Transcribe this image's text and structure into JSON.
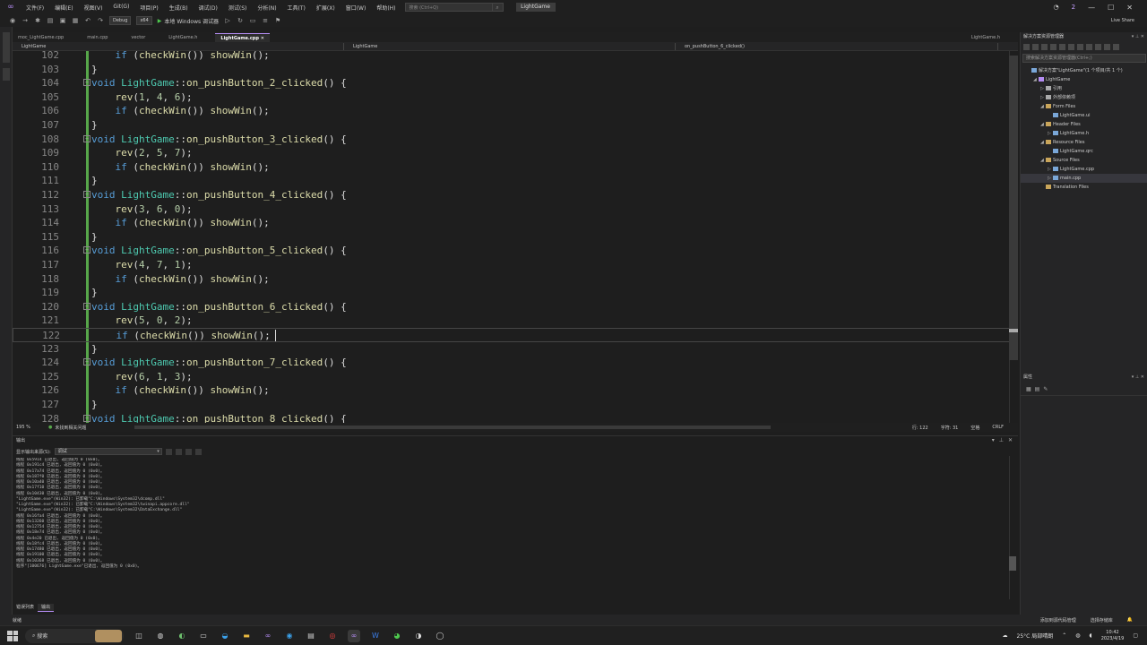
{
  "menu": {
    "items": [
      "文件(F)",
      "编辑(E)",
      "视图(V)",
      "Git(G)",
      "项目(P)",
      "生成(B)",
      "调试(D)",
      "测试(S)",
      "分析(N)",
      "工具(T)",
      "扩展(X)",
      "窗口(W)",
      "帮助(H)"
    ],
    "search_placeholder": "搜索 (Ctrl+Q)",
    "app_title": "LightGame",
    "notif_count": "2"
  },
  "toolbar": {
    "config": "Debug",
    "platform": "x64",
    "run_label": "本地 Windows 调试器",
    "live_share": "Live Share"
  },
  "tabs": [
    "moc_LightGame.cpp",
    "main.cpp",
    "vector",
    "LightGame.h",
    "LightGame.cpp",
    "LightGame.h"
  ],
  "navbar": {
    "project": "LightGame",
    "scope": "LightGame",
    "member": "on_pushButton_6_clicked()"
  },
  "code_lines": [
    {
      "n": "102",
      "t": "    if (checkWin()) showWin();"
    },
    {
      "n": "103",
      "t": "}"
    },
    {
      "n": "104",
      "t": "void LightGame::on_pushButton_2_clicked() {"
    },
    {
      "n": "105",
      "t": "    rev(1, 4, 6);"
    },
    {
      "n": "106",
      "t": "    if (checkWin()) showWin();"
    },
    {
      "n": "107",
      "t": "}"
    },
    {
      "n": "108",
      "t": "void LightGame::on_pushButton_3_clicked() {"
    },
    {
      "n": "109",
      "t": "    rev(2, 5, 7);"
    },
    {
      "n": "110",
      "t": "    if (checkWin()) showWin();"
    },
    {
      "n": "111",
      "t": "}"
    },
    {
      "n": "112",
      "t": "void LightGame::on_pushButton_4_clicked() {"
    },
    {
      "n": "113",
      "t": "    rev(3, 6, 0);"
    },
    {
      "n": "114",
      "t": "    if (checkWin()) showWin();"
    },
    {
      "n": "115",
      "t": "}"
    },
    {
      "n": "116",
      "t": "void LightGame::on_pushButton_5_clicked() {"
    },
    {
      "n": "117",
      "t": "    rev(4, 7, 1);"
    },
    {
      "n": "118",
      "t": "    if (checkWin()) showWin();"
    },
    {
      "n": "119",
      "t": "}"
    },
    {
      "n": "120",
      "t": "void LightGame::on_pushButton_6_clicked() {"
    },
    {
      "n": "121",
      "t": "    rev(5, 0, 2);"
    },
    {
      "n": "122",
      "t": "    if (checkWin()) showWin();"
    },
    {
      "n": "123",
      "t": "}"
    },
    {
      "n": "124",
      "t": "void LightGame::on_pushButton_7_clicked() {"
    },
    {
      "n": "125",
      "t": "    rev(6, 1, 3);"
    },
    {
      "n": "126",
      "t": "    if (checkWin()) showWin();"
    },
    {
      "n": "127",
      "t": "}"
    },
    {
      "n": "128",
      "t": "void LightGame::on_pushButton_8_clicked() {"
    }
  ],
  "current_line": "122",
  "editor_status": {
    "zoom": "195 %",
    "issues": "未找到相关问题",
    "line": "行: 122",
    "col": "字符: 31",
    "mode": "空格",
    "eol": "CRLF"
  },
  "output": {
    "title": "输出",
    "source_label": "显示输出来源(S):",
    "source_value": "调试",
    "lines": [
      "线程 0x5914 已退出, 返回值为 0 (0x0)。",
      "线程 0x191c4 已退出, 返回值为 0 (0x0)。",
      "线程 0x17a74 已退出, 返回值为 0 (0x0)。",
      "线程 0x187f0 已退出, 返回值为 0 (0x0)。",
      "线程 0x10a40 已退出, 返回值为 0 (0x0)。",
      "线程 0x17f10 已退出, 返回值为 0 (0x0)。",
      "线程 0x10430 已退出, 返回值为 0 (0x0)。",
      "\"LightGame.exe\"(Win32): 已卸载\"C:\\Windows\\System32\\dcomp.dll\"",
      "\"LightGame.exe\"(Win32): 已卸载\"C:\\Windows\\System32\\twinapi.appcore.dll\"",
      "\"LightGame.exe\"(Win32): 已卸载\"C:\\Windows\\System32\\DataExchange.dll\"",
      "线程 0x16fa4 已退出, 返回值为 0 (0x0)。",
      "线程 0x13260 已退出, 返回值为 0 (0x0)。",
      "线程 0x12754 已退出, 返回值为 0 (0x0)。",
      "线程 0x18e74 已退出, 返回值为 0 (0x0)。",
      "线程 0x4e20 已退出, 返回值为 0 (0x0)。",
      "线程 0x18fc4 已退出, 返回值为 0 (0x0)。",
      "线程 0x17480 已退出, 返回值为 0 (0x0)。",
      "线程 0x19100 已退出, 返回值为 0 (0x0)。",
      "线程 0x10368 已退出, 返回值为 0 (0x0)。",
      "程序\"[100676] LightGame.exe\"已退出, 返回值为 0 (0x0)。"
    ]
  },
  "bottom_tabs": [
    "错误列表",
    "输出"
  ],
  "solution": {
    "title": "解决方案资源管理器",
    "search_placeholder": "搜索解决方案资源管理器(Ctrl+;)",
    "items": [
      {
        "label": "解决方案\"LightGame\"(1 个项目/共 1 个)",
        "indent": 0,
        "arrow": ""
      },
      {
        "label": "LightGame",
        "indent": 1,
        "arrow": "◢"
      },
      {
        "label": "引用",
        "indent": 2,
        "arrow": "▷"
      },
      {
        "label": "外部依赖项",
        "indent": 2,
        "arrow": "▷"
      },
      {
        "label": "Form Files",
        "indent": 2,
        "arrow": "◢"
      },
      {
        "label": "LightGame.ui",
        "indent": 3,
        "arrow": ""
      },
      {
        "label": "Header Files",
        "indent": 2,
        "arrow": "◢"
      },
      {
        "label": "LightGame.h",
        "indent": 3,
        "arrow": "▷"
      },
      {
        "label": "Resource Files",
        "indent": 2,
        "arrow": "◢"
      },
      {
        "label": "LightGame.qrc",
        "indent": 3,
        "arrow": ""
      },
      {
        "label": "Source Files",
        "indent": 2,
        "arrow": "◢"
      },
      {
        "label": "LightGame.cpp",
        "indent": 3,
        "arrow": "▷"
      },
      {
        "label": "main.cpp",
        "indent": 3,
        "arrow": "▷"
      },
      {
        "label": "Translation Files",
        "indent": 2,
        "arrow": ""
      }
    ]
  },
  "properties": {
    "title": "属性"
  },
  "statusbar": {
    "left": "就绪",
    "source_control": "添加到源代码管理",
    "repo": "选择存储库"
  },
  "taskbar": {
    "search": "搜索",
    "weather": "25°C 局部晴朗",
    "time": "10:42",
    "date": "2023/4/19"
  }
}
